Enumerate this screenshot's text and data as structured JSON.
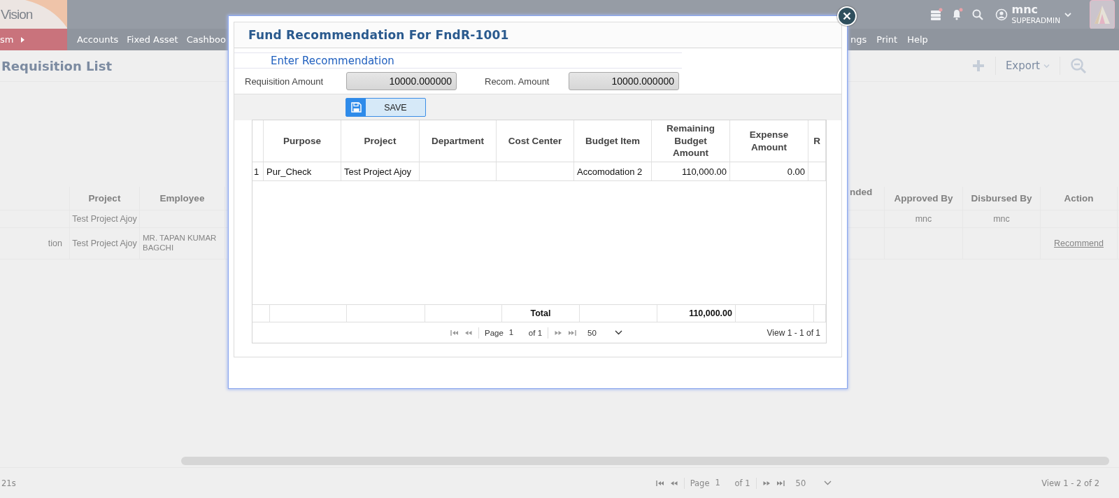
{
  "header": {
    "logo_text": "Vision",
    "user_name": "mnc",
    "user_role": "SUPERADMIN"
  },
  "nav": {
    "module": "sm",
    "items_left": [
      "Accounts",
      "Fixed Asset",
      "Cashboo"
    ],
    "items_right": [
      "ngs",
      "Print",
      "Help"
    ]
  },
  "page": {
    "title": "Requisition List",
    "export_label": "Export"
  },
  "list": {
    "columns": [
      "",
      "Project",
      "Employee",
      "nded",
      "Approved By",
      "Disbursed By",
      "Action"
    ],
    "rows": [
      {
        "cells": [
          "",
          "Test Project Ajoy",
          "",
          "",
          "mnc",
          "mnc",
          ""
        ]
      },
      {
        "cells": [
          "tion",
          "Test Project Ajoy",
          "MR. TAPAN KUMAR BAGCHI",
          "",
          "",
          "",
          "Recommend"
        ]
      }
    ],
    "footer_left": "21s",
    "pager": {
      "page_label": "Page",
      "page": "1",
      "of": "of 1",
      "page_size": "50",
      "view": "View 1 - 2 of 2"
    }
  },
  "modal": {
    "title": "Fund Recommendation For FndR-1001",
    "section_title": "Enter Recommendation",
    "fields": [
      {
        "label": "Requisition Amount",
        "value": "10000.000000"
      },
      {
        "label": "Recom. Amount",
        "value": "10000.000000"
      }
    ],
    "save_label": "SAVE",
    "columns": [
      "",
      "Purpose",
      "Project",
      "Department",
      "Cost Center",
      "Budget Item",
      "Remaining Budget Amount",
      "Expense Amount",
      "R"
    ],
    "rows": [
      {
        "cells": [
          "1",
          "Pur_Check",
          "Test Project Ajoy",
          "",
          "",
          "Accomodation 2",
          "110,000.00",
          "0.00",
          ""
        ]
      }
    ],
    "totals": {
      "label": "Total",
      "value": "110,000.00"
    },
    "pager": {
      "page_label": "Page",
      "page": "1",
      "of": "of 1",
      "page_size": "50",
      "view": "View 1 - 1 of 1"
    }
  }
}
